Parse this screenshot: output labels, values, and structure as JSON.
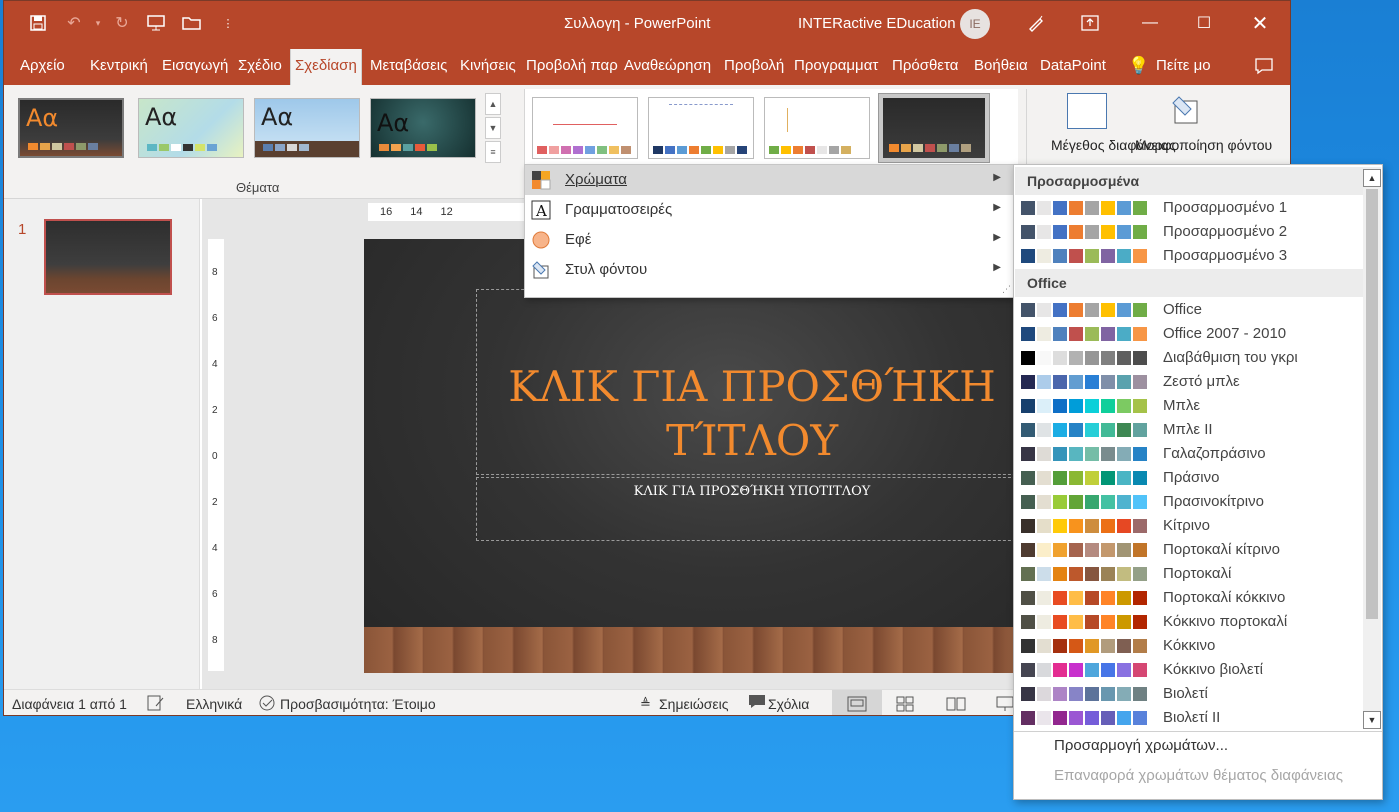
{
  "window": {
    "doc_title": "Συλλογη  -  PowerPoint",
    "user_name": "INTERactive EDucation",
    "user_initials": "IE"
  },
  "tabs": [
    "Αρχείο",
    "Κεντρική",
    "Εισαγωγή",
    "Σχέδιο",
    "Σχεδίαση",
    "Μεταβάσεις",
    "Κινήσεις",
    "Προβολή παρ",
    "Αναθεώρηση",
    "Προβολή",
    "Προγραμματ",
    "Πρόσθετα",
    "Βοήθεια",
    "DataPoint",
    "Πείτε μο"
  ],
  "active_tab": "Σχεδίαση",
  "ribbon": {
    "themes_label": "Θέματα",
    "theme_aa": "Αα",
    "slide_size_label": "Μέγεθος διαφάνειας",
    "format_bg_label": "Μορφοποίηση φόντου"
  },
  "slide_pane": {
    "slide_number": "1"
  },
  "ruler": {
    "h_ticks": [
      "16",
      "14",
      "12"
    ],
    "v_ticks": [
      "8",
      "6",
      "4",
      "2",
      "0",
      "2",
      "4",
      "6",
      "8"
    ]
  },
  "slide": {
    "title": "ΚΛΙΚ ΓΙΑ ΠΡΟΣΘΉΚΗ ΤΊΤΛΟΥ",
    "subtitle": "ΚΛΙΚ ΓΙΑ ΠΡΟΣΘΉΚΗ ΥΠΟΤΙΤΛΟΥ"
  },
  "design_menu": [
    {
      "label": "Χρώματα",
      "icon": "colors-icon"
    },
    {
      "label": "Γραμματοσειρές",
      "icon": "fonts-icon"
    },
    {
      "label": "Εφέ",
      "icon": "effects-icon"
    },
    {
      "label": "Στυλ φόντου",
      "icon": "background-style-icon"
    }
  ],
  "colors_panel": {
    "custom_header": "Προσαρμοσμένα",
    "office_header": "Office",
    "custom": [
      {
        "name": "Προσαρμοσμένο 1",
        "colors": [
          "#44546a",
          "#e7e6e6",
          "#4472c4",
          "#ed7d31",
          "#a5a5a5",
          "#ffc000",
          "#5b9bd5",
          "#70ad47"
        ]
      },
      {
        "name": "Προσαρμοσμένο 2",
        "colors": [
          "#44546a",
          "#e7e6e6",
          "#4472c4",
          "#ed7d31",
          "#a5a5a5",
          "#ffc000",
          "#5b9bd5",
          "#70ad47"
        ]
      },
      {
        "name": "Προσαρμοσμένο 3",
        "colors": [
          "#1f497d",
          "#eeece1",
          "#4f81bd",
          "#c0504d",
          "#9bbb59",
          "#8064a2",
          "#4bacc6",
          "#f79646"
        ]
      }
    ],
    "office": [
      {
        "name": "Office",
        "colors": [
          "#44546a",
          "#e7e6e6",
          "#4472c4",
          "#ed7d31",
          "#a5a5a5",
          "#ffc000",
          "#5b9bd5",
          "#70ad47"
        ]
      },
      {
        "name": "Office 2007 - 2010",
        "colors": [
          "#1f497d",
          "#eeece1",
          "#4f81bd",
          "#c0504d",
          "#9bbb59",
          "#8064a2",
          "#4bacc6",
          "#f79646"
        ]
      },
      {
        "name": "Διαβάθμιση του γκρι",
        "colors": [
          "#000000",
          "#f8f8f8",
          "#dddddd",
          "#b2b2b2",
          "#969696",
          "#808080",
          "#5f5f5f",
          "#4d4d4d"
        ]
      },
      {
        "name": "Ζεστό μπλε",
        "colors": [
          "#242852",
          "#acccea",
          "#4a66ac",
          "#629dd1",
          "#297fd5",
          "#7f8fa9",
          "#5aa2ae",
          "#9d90a0"
        ]
      },
      {
        "name": "Μπλε",
        "colors": [
          "#17406d",
          "#dbeff9",
          "#0f6fc6",
          "#009dd9",
          "#0bd0d9",
          "#10cf9b",
          "#7cca62",
          "#a5c249"
        ]
      },
      {
        "name": "Μπλε ΙΙ",
        "colors": [
          "#335b74",
          "#dfe3e5",
          "#1cade4",
          "#2683c6",
          "#27ced7",
          "#42ba97",
          "#3e8853",
          "#62a39f"
        ]
      },
      {
        "name": "Γαλαζοπράσινο",
        "colors": [
          "#373545",
          "#dedbd6",
          "#3494ba",
          "#58b6c0",
          "#75bda7",
          "#7a8c8e",
          "#84acb6",
          "#2683c6"
        ]
      },
      {
        "name": "Πράσινο",
        "colors": [
          "#455f51",
          "#e3ded1",
          "#549e39",
          "#8ab833",
          "#c0cf3a",
          "#029676",
          "#4ab5c4",
          "#0989b1"
        ]
      },
      {
        "name": "Πρασινοκίτρινο",
        "colors": [
          "#455f51",
          "#e3ded1",
          "#99cb38",
          "#63a537",
          "#37a76f",
          "#44c1a3",
          "#4eb3cf",
          "#51c3f9"
        ]
      },
      {
        "name": "Κίτρινο",
        "colors": [
          "#39302a",
          "#e5dec9",
          "#ffca08",
          "#f8931d",
          "#ce8d3e",
          "#ec7016",
          "#e64823",
          "#9c6a6a"
        ]
      },
      {
        "name": "Πορτοκαλί κίτρινο",
        "colors": [
          "#4e3b30",
          "#fbeec9",
          "#f0a22e",
          "#a5644e",
          "#b58b80",
          "#c3986d",
          "#a19574",
          "#c17529"
        ]
      },
      {
        "name": "Πορτοκαλί",
        "colors": [
          "#637052",
          "#ccddea",
          "#e48312",
          "#bd582c",
          "#865640",
          "#9b8357",
          "#c2bc80",
          "#94a088"
        ]
      },
      {
        "name": "Πορτοκαλί κόκκινο",
        "colors": [
          "#505046",
          "#eeece1",
          "#e84c22",
          "#ffbd47",
          "#b64926",
          "#ff8427",
          "#cc9900",
          "#b22600"
        ]
      },
      {
        "name": "Κόκκινο πορτοκαλί",
        "colors": [
          "#505046",
          "#eeece1",
          "#e84c22",
          "#ffbd47",
          "#b64926",
          "#ff8427",
          "#cc9900",
          "#b22600"
        ]
      },
      {
        "name": "Κόκκινο",
        "colors": [
          "#323232",
          "#e3ded1",
          "#a5300f",
          "#d55816",
          "#e19825",
          "#b19c7d",
          "#7f5f52",
          "#b27d49"
        ]
      },
      {
        "name": "Κόκκινο βιολετί",
        "colors": [
          "#454551",
          "#d8d9dc",
          "#e32d91",
          "#c830cc",
          "#4ea6dc",
          "#4775e7",
          "#8971e1",
          "#d54773"
        ]
      },
      {
        "name": "Βιολετί",
        "colors": [
          "#373545",
          "#dcd8dc",
          "#ad84c6",
          "#8784c7",
          "#5d739a",
          "#6997af",
          "#84acb6",
          "#6f8183"
        ]
      },
      {
        "name": "Βιολετί ΙΙ",
        "colors": [
          "#632e62",
          "#eae5eb",
          "#92278f",
          "#9b57d3",
          "#755dd9",
          "#665eb8",
          "#45a5ed",
          "#5982db"
        ]
      }
    ],
    "action_customize": "Προσαρμογή χρωμάτων...",
    "action_reset": "Επαναφορά χρωμάτων θέματος διαφάνειας"
  },
  "statusbar": {
    "slide_info": "Διαφάνεια 1 από 1",
    "language": "Ελληνικά",
    "accessibility": "Προσβασιμότητα: Έτοιμο",
    "notes": "Σημειώσεις",
    "comments": "Σχόλια"
  }
}
